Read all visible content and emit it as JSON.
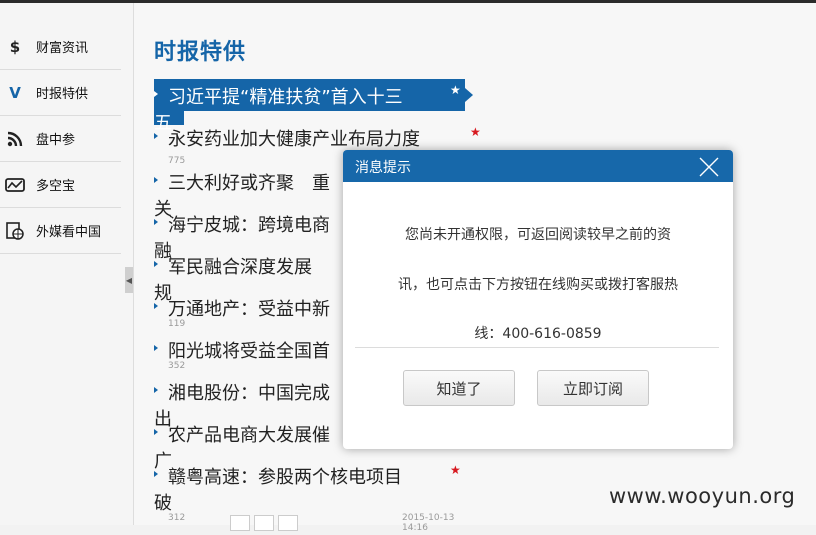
{
  "sidebar": {
    "items": [
      {
        "label": "财富资讯",
        "icon": "dollar-doc-icon"
      },
      {
        "label": "时报特供",
        "icon": "v-logo-icon"
      },
      {
        "label": "盘中参",
        "icon": "rss-icon"
      },
      {
        "label": "多空宝",
        "icon": "chart-box-icon"
      },
      {
        "label": "外媒看中国",
        "icon": "globe-doc-icon"
      }
    ]
  },
  "main": {
    "title": "时报特供",
    "news": [
      {
        "title": "习近平提“精准扶贫”首入十三",
        "wrap": "五",
        "meta": ""
      },
      {
        "title": "永安药业加大健康产业布局力度",
        "wrap": "",
        "meta": "775"
      },
      {
        "title": "三大利好或齐聚　重",
        "wrap": "关",
        "meta": ""
      },
      {
        "title": "海宁皮城：跨境电商",
        "wrap": "融",
        "meta": ""
      },
      {
        "title": "军民融合深度发展",
        "wrap": "规",
        "meta": ""
      },
      {
        "title": "万通地产：受益中新",
        "wrap": "",
        "meta": "119"
      },
      {
        "title": "阳光城将受益全国首",
        "wrap": "",
        "meta": "352"
      },
      {
        "title": "湘电股份：中国完成",
        "wrap": "出",
        "meta": ""
      },
      {
        "title": "农产品电商大发展催",
        "wrap": "广",
        "meta": ""
      },
      {
        "title": "赣粤高速：参股两个核电项目",
        "wrap": "破",
        "meta": "312"
      }
    ],
    "bottom_meta": "2015-10-13 14:16"
  },
  "dialog": {
    "title": "消息提示",
    "line1": "您尚未开通权限，可返回阅读较早之前的资",
    "line2": "讯，也可点击下方按钮在线购买或拨打客服热",
    "line3": "线：400-616-0859",
    "ok_label": "知道了",
    "subscribe_label": "立即订阅"
  },
  "watermark": "www.wooyun.org",
  "colors": {
    "accent": "#1565a8",
    "star": "#d71920"
  }
}
